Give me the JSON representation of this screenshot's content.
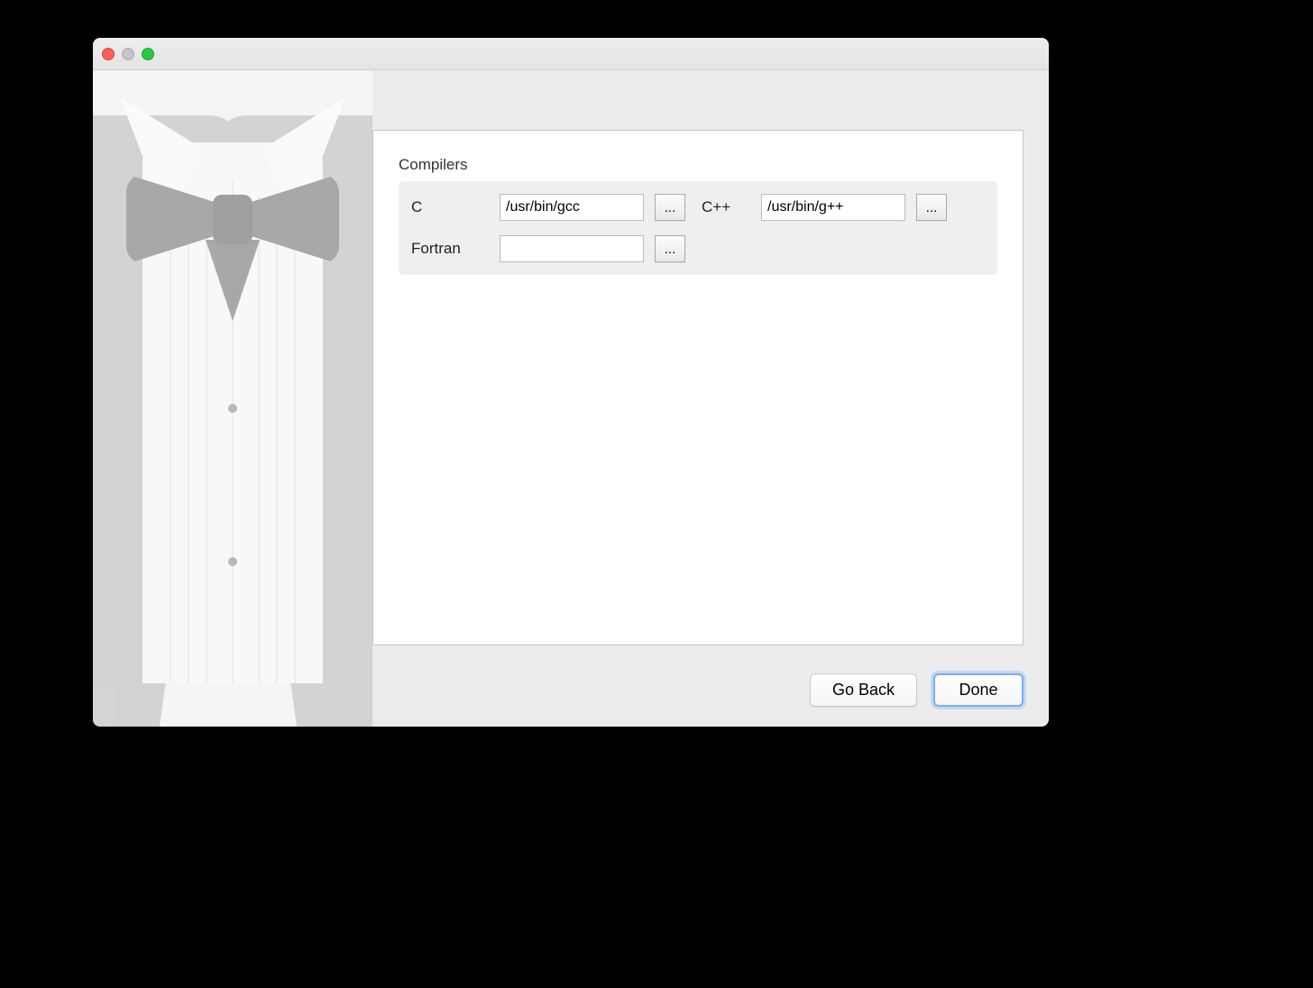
{
  "section": {
    "title": "Compilers"
  },
  "compilers": {
    "c": {
      "label": "C",
      "value": "/usr/bin/gcc",
      "browse": "..."
    },
    "cpp": {
      "label": "C++",
      "value": "/usr/bin/g++",
      "browse": "..."
    },
    "fortran": {
      "label": "Fortran",
      "value": "",
      "browse": "..."
    }
  },
  "buttons": {
    "back": "Go Back",
    "done": "Done"
  }
}
